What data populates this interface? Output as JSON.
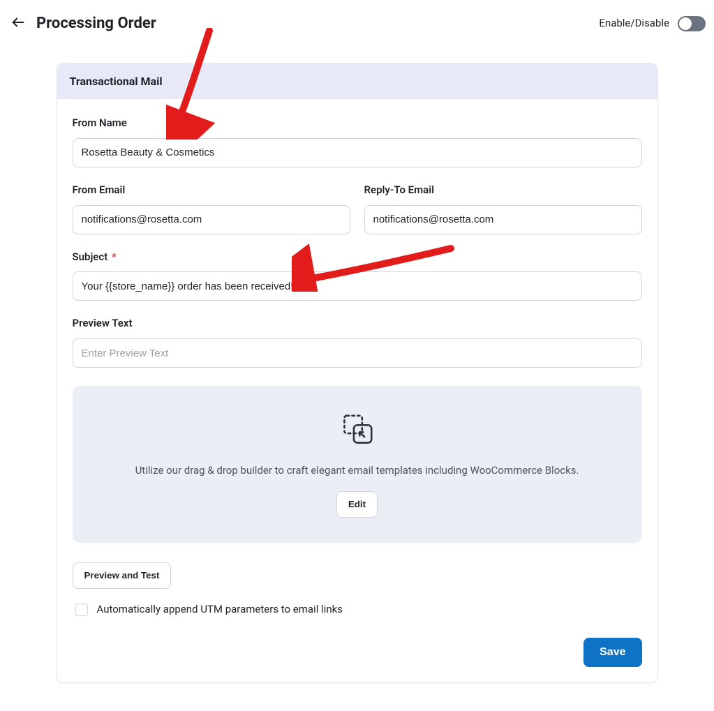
{
  "header": {
    "title": "Processing Order",
    "toggle_label": "Enable/Disable"
  },
  "panel": {
    "title": "Transactional Mail",
    "from_name_label": "From Name",
    "from_name_value": "Rosetta Beauty & Cosmetics",
    "from_email_label": "From Email",
    "from_email_value": "notifications@rosetta.com",
    "reply_to_label": "Reply-To Email",
    "reply_to_value": "notifications@rosetta.com",
    "subject_label": "Subject",
    "subject_required": "*",
    "subject_value": "Your {{store_name}} order has been received!",
    "preview_label": "Preview Text",
    "preview_placeholder": "Enter Preview Text",
    "builder_desc": "Utilize our drag & drop builder to craft elegant email templates including WooCommerce Blocks.",
    "edit_label": "Edit",
    "preview_test_label": "Preview and Test",
    "utm_label": "Automatically append UTM parameters to email links",
    "save_label": "Save"
  }
}
